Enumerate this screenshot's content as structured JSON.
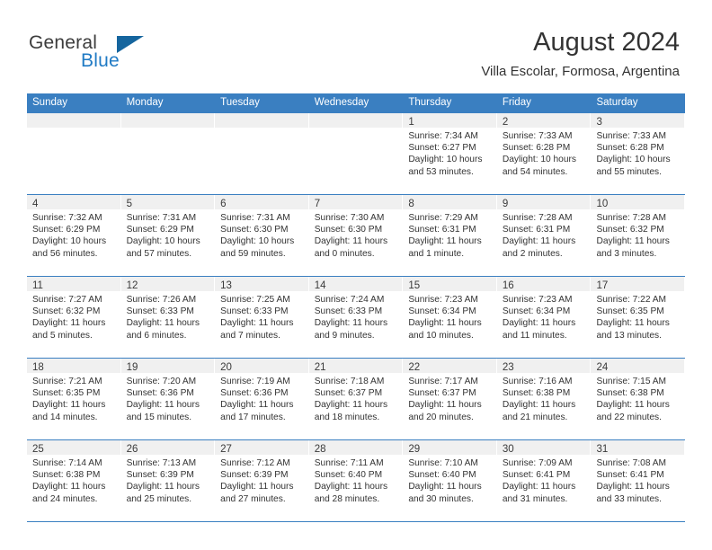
{
  "brand": {
    "word1": "General",
    "word2": "Blue",
    "triangle_color": "#15659e",
    "blue_color": "#1f7ac4"
  },
  "header": {
    "title": "August 2024",
    "subtitle": "Villa Escolar, Formosa, Argentina"
  },
  "theme": {
    "header_blue": "#3a7fc1",
    "daynum_band": "#f0f0f0",
    "text": "#333333"
  },
  "weekdays": [
    "Sunday",
    "Monday",
    "Tuesday",
    "Wednesday",
    "Thursday",
    "Friday",
    "Saturday"
  ],
  "weeks": [
    [
      {
        "day": "",
        "empty": true
      },
      {
        "day": "",
        "empty": true
      },
      {
        "day": "",
        "empty": true
      },
      {
        "day": "",
        "empty": true
      },
      {
        "day": "1",
        "sunrise": "Sunrise: 7:34 AM",
        "sunset": "Sunset: 6:27 PM",
        "daylight": "Daylight: 10 hours and 53 minutes."
      },
      {
        "day": "2",
        "sunrise": "Sunrise: 7:33 AM",
        "sunset": "Sunset: 6:28 PM",
        "daylight": "Daylight: 10 hours and 54 minutes."
      },
      {
        "day": "3",
        "sunrise": "Sunrise: 7:33 AM",
        "sunset": "Sunset: 6:28 PM",
        "daylight": "Daylight: 10 hours and 55 minutes."
      }
    ],
    [
      {
        "day": "4",
        "sunrise": "Sunrise: 7:32 AM",
        "sunset": "Sunset: 6:29 PM",
        "daylight": "Daylight: 10 hours and 56 minutes."
      },
      {
        "day": "5",
        "sunrise": "Sunrise: 7:31 AM",
        "sunset": "Sunset: 6:29 PM",
        "daylight": "Daylight: 10 hours and 57 minutes."
      },
      {
        "day": "6",
        "sunrise": "Sunrise: 7:31 AM",
        "sunset": "Sunset: 6:30 PM",
        "daylight": "Daylight: 10 hours and 59 minutes."
      },
      {
        "day": "7",
        "sunrise": "Sunrise: 7:30 AM",
        "sunset": "Sunset: 6:30 PM",
        "daylight": "Daylight: 11 hours and 0 minutes."
      },
      {
        "day": "8",
        "sunrise": "Sunrise: 7:29 AM",
        "sunset": "Sunset: 6:31 PM",
        "daylight": "Daylight: 11 hours and 1 minute."
      },
      {
        "day": "9",
        "sunrise": "Sunrise: 7:28 AM",
        "sunset": "Sunset: 6:31 PM",
        "daylight": "Daylight: 11 hours and 2 minutes."
      },
      {
        "day": "10",
        "sunrise": "Sunrise: 7:28 AM",
        "sunset": "Sunset: 6:32 PM",
        "daylight": "Daylight: 11 hours and 3 minutes."
      }
    ],
    [
      {
        "day": "11",
        "sunrise": "Sunrise: 7:27 AM",
        "sunset": "Sunset: 6:32 PM",
        "daylight": "Daylight: 11 hours and 5 minutes."
      },
      {
        "day": "12",
        "sunrise": "Sunrise: 7:26 AM",
        "sunset": "Sunset: 6:33 PM",
        "daylight": "Daylight: 11 hours and 6 minutes."
      },
      {
        "day": "13",
        "sunrise": "Sunrise: 7:25 AM",
        "sunset": "Sunset: 6:33 PM",
        "daylight": "Daylight: 11 hours and 7 minutes."
      },
      {
        "day": "14",
        "sunrise": "Sunrise: 7:24 AM",
        "sunset": "Sunset: 6:33 PM",
        "daylight": "Daylight: 11 hours and 9 minutes."
      },
      {
        "day": "15",
        "sunrise": "Sunrise: 7:23 AM",
        "sunset": "Sunset: 6:34 PM",
        "daylight": "Daylight: 11 hours and 10 minutes."
      },
      {
        "day": "16",
        "sunrise": "Sunrise: 7:23 AM",
        "sunset": "Sunset: 6:34 PM",
        "daylight": "Daylight: 11 hours and 11 minutes."
      },
      {
        "day": "17",
        "sunrise": "Sunrise: 7:22 AM",
        "sunset": "Sunset: 6:35 PM",
        "daylight": "Daylight: 11 hours and 13 minutes."
      }
    ],
    [
      {
        "day": "18",
        "sunrise": "Sunrise: 7:21 AM",
        "sunset": "Sunset: 6:35 PM",
        "daylight": "Daylight: 11 hours and 14 minutes."
      },
      {
        "day": "19",
        "sunrise": "Sunrise: 7:20 AM",
        "sunset": "Sunset: 6:36 PM",
        "daylight": "Daylight: 11 hours and 15 minutes."
      },
      {
        "day": "20",
        "sunrise": "Sunrise: 7:19 AM",
        "sunset": "Sunset: 6:36 PM",
        "daylight": "Daylight: 11 hours and 17 minutes."
      },
      {
        "day": "21",
        "sunrise": "Sunrise: 7:18 AM",
        "sunset": "Sunset: 6:37 PM",
        "daylight": "Daylight: 11 hours and 18 minutes."
      },
      {
        "day": "22",
        "sunrise": "Sunrise: 7:17 AM",
        "sunset": "Sunset: 6:37 PM",
        "daylight": "Daylight: 11 hours and 20 minutes."
      },
      {
        "day": "23",
        "sunrise": "Sunrise: 7:16 AM",
        "sunset": "Sunset: 6:38 PM",
        "daylight": "Daylight: 11 hours and 21 minutes."
      },
      {
        "day": "24",
        "sunrise": "Sunrise: 7:15 AM",
        "sunset": "Sunset: 6:38 PM",
        "daylight": "Daylight: 11 hours and 22 minutes."
      }
    ],
    [
      {
        "day": "25",
        "sunrise": "Sunrise: 7:14 AM",
        "sunset": "Sunset: 6:38 PM",
        "daylight": "Daylight: 11 hours and 24 minutes."
      },
      {
        "day": "26",
        "sunrise": "Sunrise: 7:13 AM",
        "sunset": "Sunset: 6:39 PM",
        "daylight": "Daylight: 11 hours and 25 minutes."
      },
      {
        "day": "27",
        "sunrise": "Sunrise: 7:12 AM",
        "sunset": "Sunset: 6:39 PM",
        "daylight": "Daylight: 11 hours and 27 minutes."
      },
      {
        "day": "28",
        "sunrise": "Sunrise: 7:11 AM",
        "sunset": "Sunset: 6:40 PM",
        "daylight": "Daylight: 11 hours and 28 minutes."
      },
      {
        "day": "29",
        "sunrise": "Sunrise: 7:10 AM",
        "sunset": "Sunset: 6:40 PM",
        "daylight": "Daylight: 11 hours and 30 minutes."
      },
      {
        "day": "30",
        "sunrise": "Sunrise: 7:09 AM",
        "sunset": "Sunset: 6:41 PM",
        "daylight": "Daylight: 11 hours and 31 minutes."
      },
      {
        "day": "31",
        "sunrise": "Sunrise: 7:08 AM",
        "sunset": "Sunset: 6:41 PM",
        "daylight": "Daylight: 11 hours and 33 minutes."
      }
    ]
  ]
}
